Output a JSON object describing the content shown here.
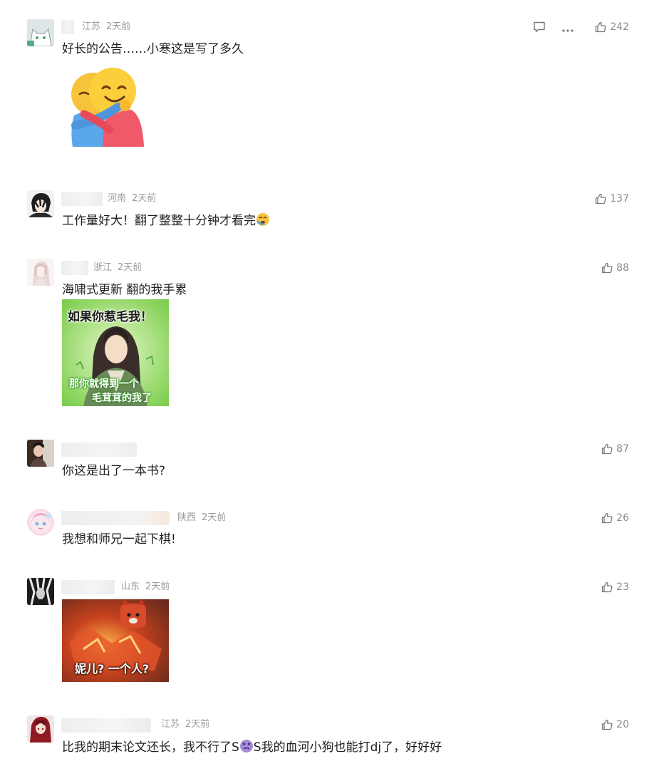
{
  "comments": [
    {
      "region": "江苏",
      "time": "2天前",
      "text": "好长的公告……小寒这是写了多久",
      "likes": "242",
      "image": "hug-emoji"
    },
    {
      "region": "河南",
      "time": "2天前",
      "text": "工作量好大！翻了整整十分钟才看完",
      "likes": "137"
    },
    {
      "region": "浙江",
      "time": "2天前",
      "text": "海啸式更新 翻的我手累",
      "likes": "88",
      "image": "meme-character",
      "image_text": {
        "top": "如果你惹毛我！",
        "bottom1": "那你就得到一个",
        "bottom2": "毛茸茸的我了"
      }
    },
    {
      "region": "",
      "time": "",
      "text": "你这是出了一本书?",
      "likes": "87"
    },
    {
      "region": "陕西",
      "time": "2天前",
      "text": "我想和师兄一起下棋!",
      "likes": "26"
    },
    {
      "region": "山东",
      "time": "2天前",
      "text": "",
      "likes": "23",
      "image": "meme-fox",
      "image_text": {
        "caption": "妮儿? 一个人?"
      }
    },
    {
      "region": "江苏",
      "time": "2天前",
      "text_a": "比我的期末论文还长，我不行了S",
      "text_b": "S我的血河小狗也能打dj了，好好好",
      "likes": "20"
    }
  ],
  "icons": {
    "reply": "comment-icon",
    "more": "more-icon",
    "like": "thumbs-up-icon"
  }
}
